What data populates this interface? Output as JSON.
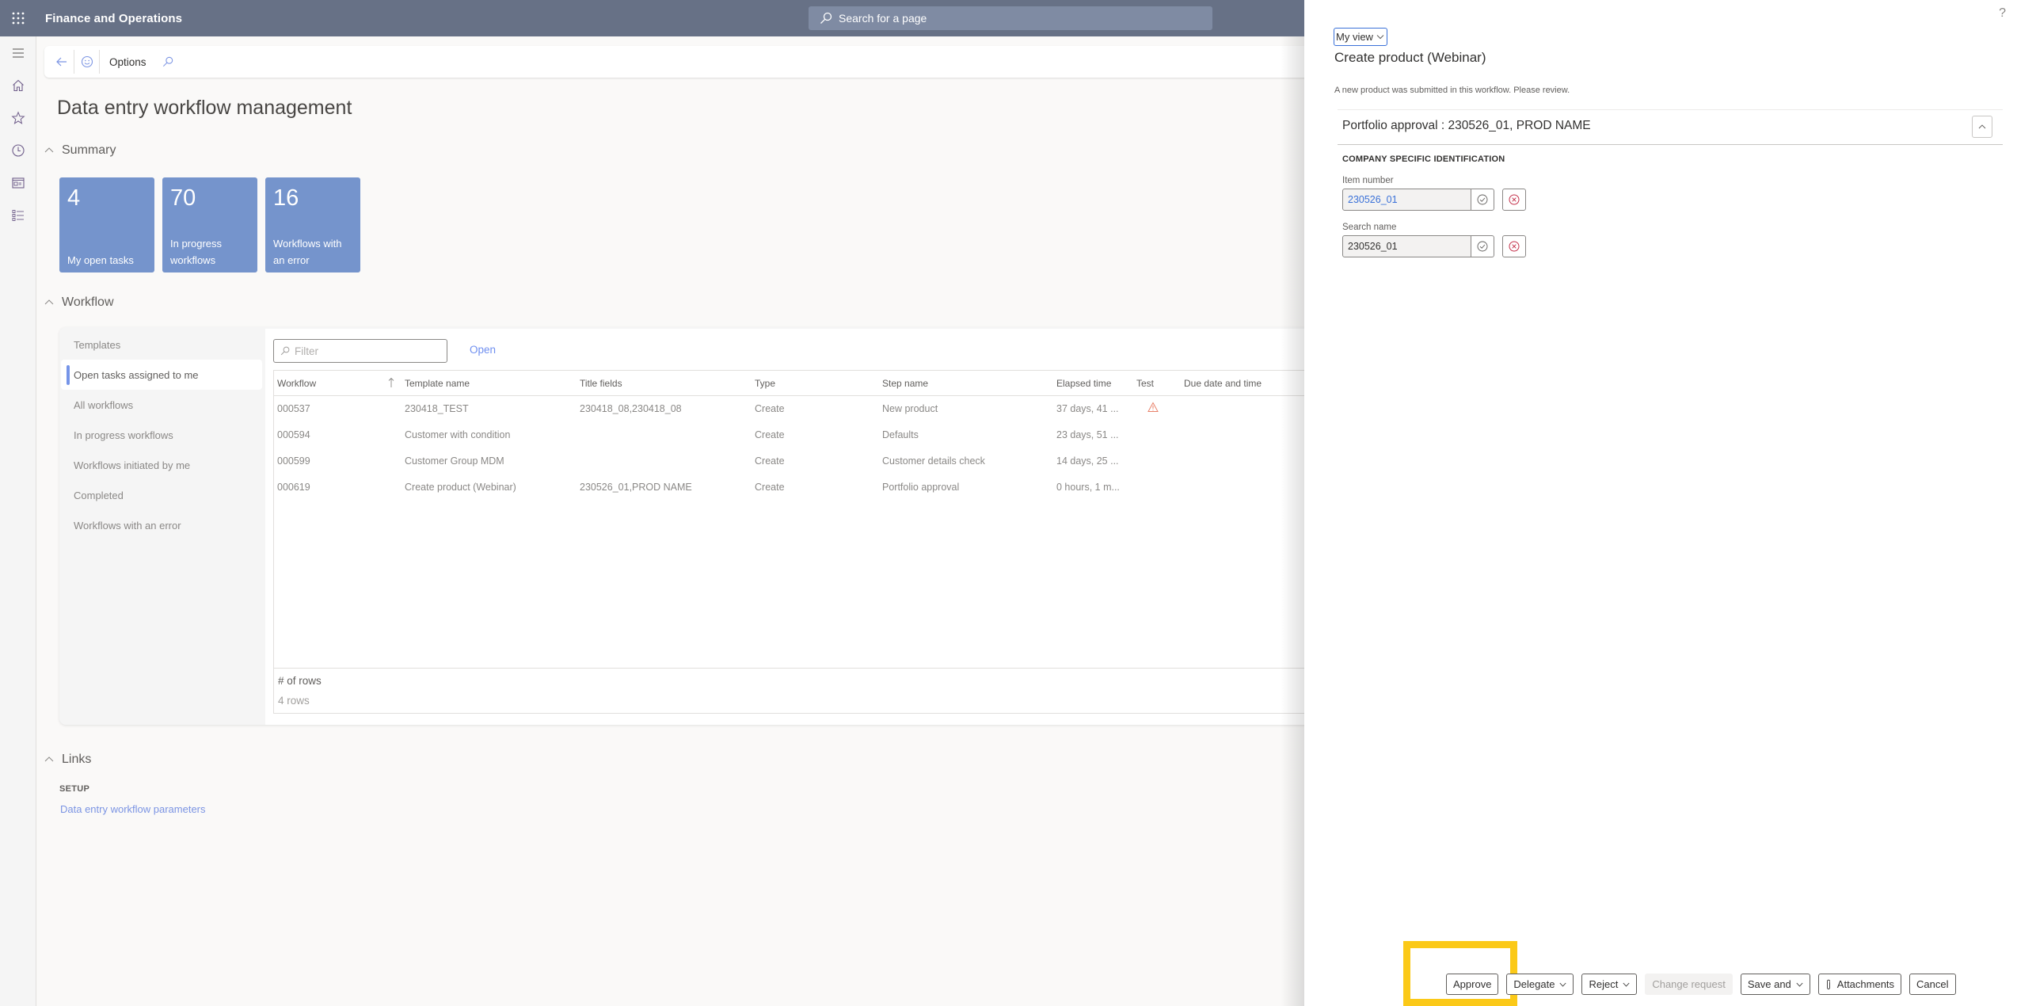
{
  "header": {
    "app_title": "Finance and Operations",
    "search_placeholder": "Search for a page"
  },
  "rail": {
    "items": [
      "menu",
      "home",
      "favorites",
      "recent",
      "workspaces",
      "modules"
    ]
  },
  "action_pane": {
    "options_label": "Options"
  },
  "page": {
    "title": "Data entry workflow management"
  },
  "summary": {
    "header": "Summary",
    "tiles": [
      {
        "count": "4",
        "label": "My open tasks"
      },
      {
        "count": "70",
        "label": "In progress workflows"
      },
      {
        "count": "16",
        "label": "Workflows with an error"
      }
    ]
  },
  "workflow": {
    "header": "Workflow",
    "nav": [
      {
        "label": "Templates",
        "active": false
      },
      {
        "label": "Open tasks assigned to me",
        "active": true
      },
      {
        "label": "All workflows",
        "active": false
      },
      {
        "label": "In progress workflows",
        "active": false
      },
      {
        "label": "Workflows initiated by me",
        "active": false
      },
      {
        "label": "Completed",
        "active": false
      },
      {
        "label": "Workflows with an error",
        "active": false
      }
    ],
    "filter_placeholder": "Filter",
    "open_label": "Open",
    "columns": [
      "Workflow",
      "Template name",
      "Title fields",
      "Type",
      "Step name",
      "Elapsed time",
      "Test",
      "Due date and time"
    ],
    "rows": [
      {
        "workflow": "000537",
        "template": "230418_TEST",
        "title_fields": "230418_08,230418_08",
        "type": "Create",
        "step": "New product",
        "elapsed": "37 days, 41 ...",
        "test_warning": true,
        "due": ""
      },
      {
        "workflow": "000594",
        "template": "Customer with condition",
        "title_fields": "",
        "type": "Create",
        "step": "Defaults",
        "elapsed": "23 days, 51 ...",
        "test_warning": false,
        "due": ""
      },
      {
        "workflow": "000599",
        "template": "Customer Group MDM",
        "title_fields": "",
        "type": "Create",
        "step": "Customer details check",
        "elapsed": "14 days, 25 ...",
        "test_warning": false,
        "due": ""
      },
      {
        "workflow": "000619",
        "template": "Create product (Webinar)",
        "title_fields": "230526_01,PROD NAME",
        "type": "Create",
        "step": "Portfolio approval",
        "elapsed": "0 hours, 1 m...",
        "test_warning": false,
        "due": ""
      }
    ],
    "rows_label": "# of rows",
    "rows_value": "4 rows"
  },
  "links": {
    "header": "Links",
    "group": "SETUP",
    "items": [
      "Data entry workflow parameters"
    ]
  },
  "side_panel": {
    "help": "?",
    "view_label": "My view",
    "title": "Create product (Webinar)",
    "description": "A new product was submitted in this workflow. Please review.",
    "fasttab_title": "Portfolio approval : 230526_01, PROD NAME",
    "group_title": "COMPANY SPECIFIC IDENTIFICATION",
    "fields": [
      {
        "label": "Item number",
        "value": "230526_01"
      },
      {
        "label": "Search name",
        "value": "230526_01"
      }
    ],
    "buttons": {
      "approve": "Approve",
      "delegate": "Delegate",
      "reject": "Reject",
      "change_request": "Change request",
      "save_and": "Save and",
      "attachments": "Attachments",
      "cancel": "Cancel"
    }
  },
  "colors": {
    "header_bg": "#677186",
    "tile_bg": "#7594cc",
    "accent_link": "#6f8ff0",
    "warning": "#e8826a",
    "highlight": "#fbc918",
    "reject_red": "#c4314b"
  }
}
